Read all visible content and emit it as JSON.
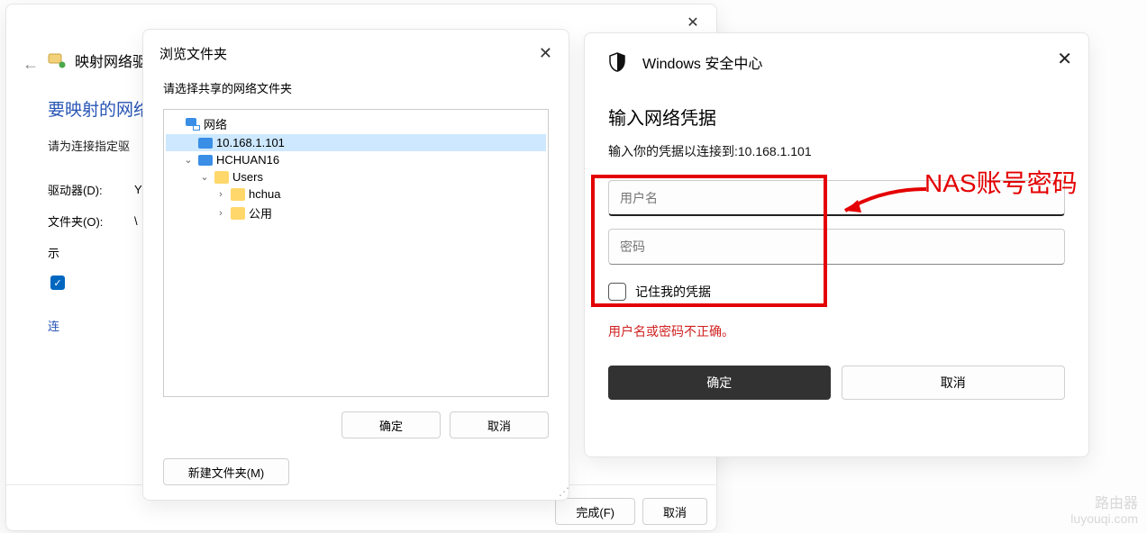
{
  "map_dialog": {
    "title": "映射网络驱动",
    "heading": "要映射的网络",
    "subtitle": "请为连接指定驱",
    "drive_label": "驱动器(D):",
    "drive_value": "Y",
    "folder_label": "文件夹(O):",
    "folder_value": "\\",
    "example": "示",
    "checkbox_stub": "",
    "link_stub": "连",
    "finish": "完成(F)",
    "cancel": "取消"
  },
  "browse_dialog": {
    "title": "浏览文件夹",
    "subtitle": "请选择共享的网络文件夹",
    "tree": {
      "network": "网络",
      "ip": "10.168.1.101",
      "host": "HCHUAN16",
      "users": "Users",
      "user1": "hchua",
      "public": "公用"
    },
    "new_folder": "新建文件夹(M)",
    "ok": "确定",
    "cancel": "取消"
  },
  "security_dialog": {
    "title": "Windows 安全中心",
    "heading": "输入网络凭据",
    "subtitle": "输入你的凭据以连接到:10.168.1.101",
    "username_placeholder": "用户名",
    "password_placeholder": "密码",
    "remember": "记住我的凭据",
    "error": "用户名或密码不正确。",
    "ok": "确定",
    "cancel": "取消"
  },
  "annotation": {
    "text": "NAS账号密码"
  },
  "watermark": {
    "line1": "路由器",
    "line2": "luyouqi.com"
  }
}
